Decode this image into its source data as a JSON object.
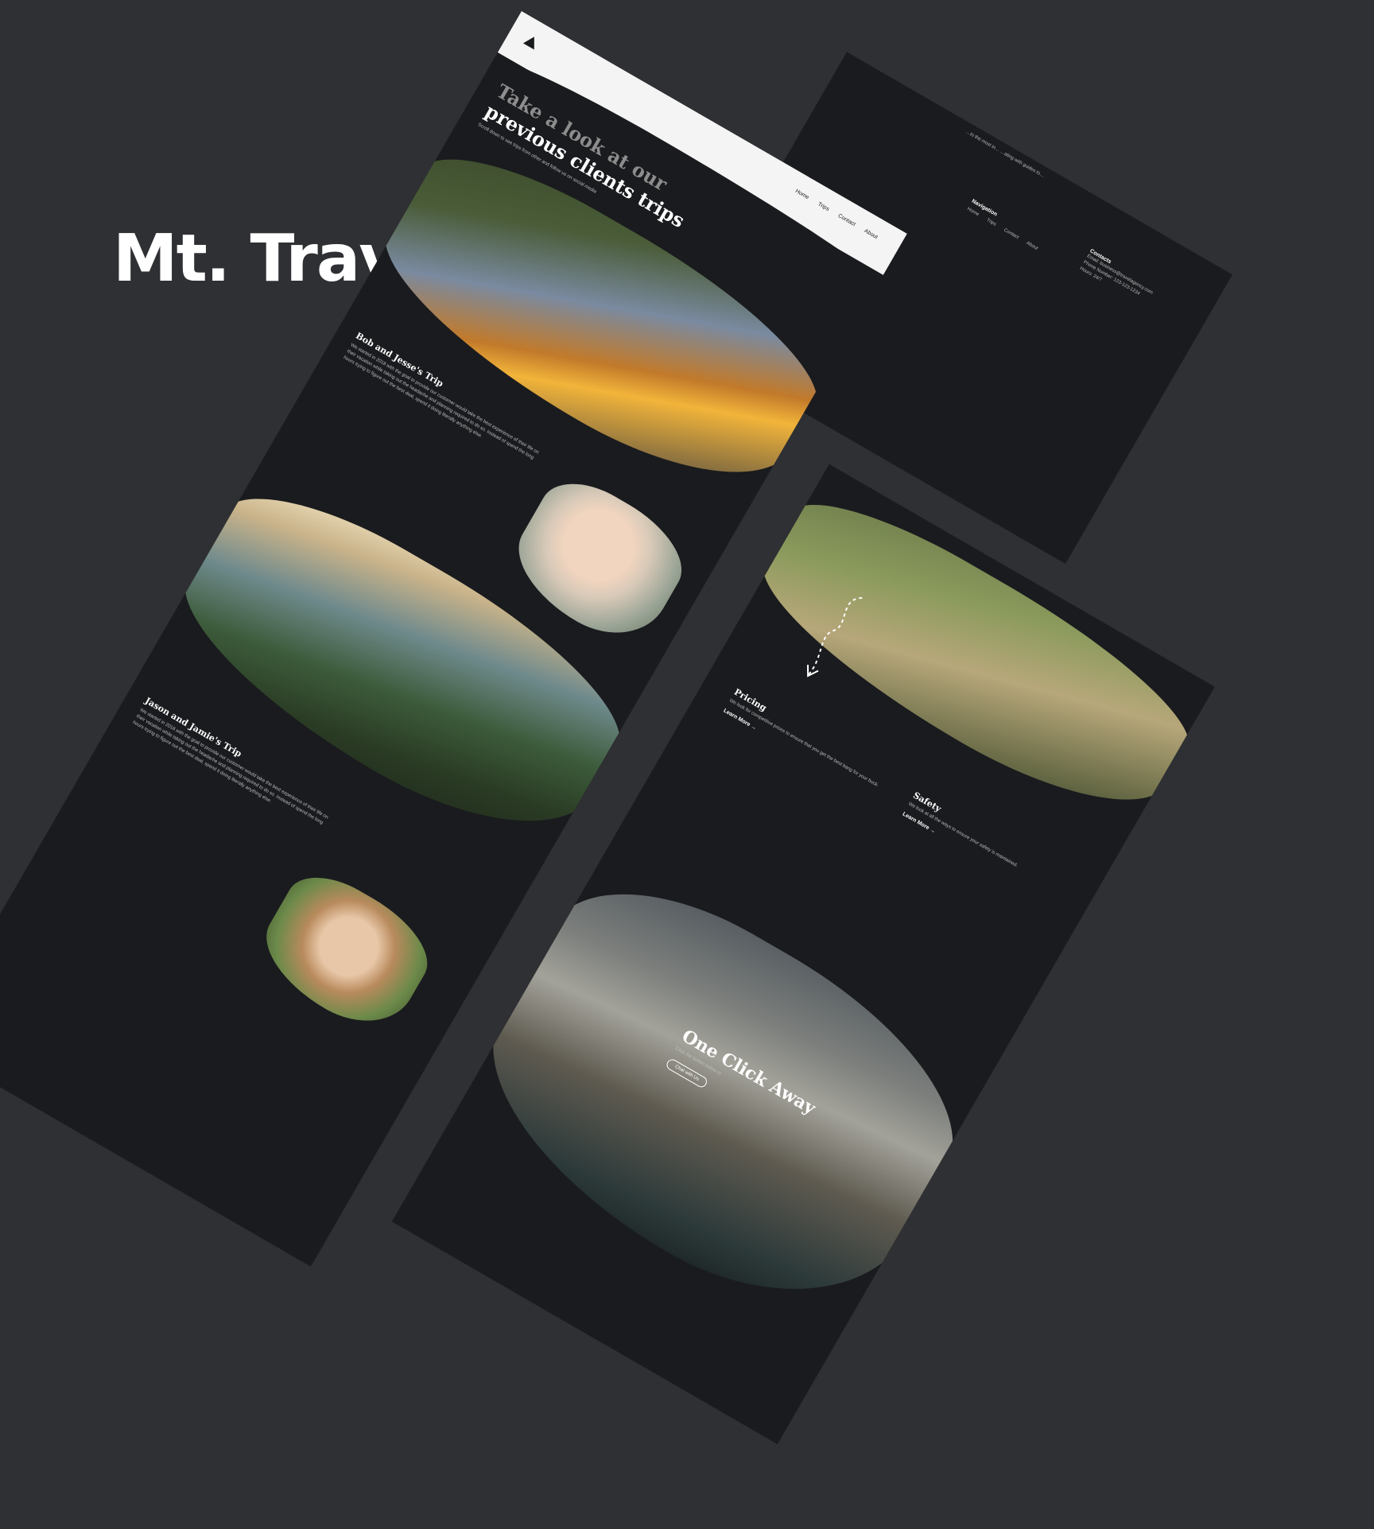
{
  "headline": "Mt. Travel Agency",
  "colors": {
    "background": "#2f3033",
    "board": "#1a1b1e",
    "text": "#ffffff"
  },
  "footer": {
    "top_text": "…to the most in… …ating with guides to…",
    "nav_heading": "Navigation",
    "nav_links": [
      "Home",
      "Trips",
      "Contact",
      "About"
    ],
    "contacts_heading": "Contacts",
    "contacts_lines": [
      "Email: business@travelagency.com",
      "Phone Number: 123-123-1234",
      "Hours: 24/7"
    ]
  },
  "trips_page": {
    "nav_links": [
      "Home",
      "Trips",
      "Contact",
      "About"
    ],
    "hero_title_line1": "Take a look at our",
    "hero_title_line2": "previous clients trips",
    "hero_subtitle": "Scroll down to see trips from other and follow us on social media",
    "trip1": {
      "title": "Bob and Jesse's Trip",
      "text": "We started in 2018 with the goal to provide our customer would take the best experience of their life on their vacation while taking out the headache and planning required to do so. Instead of spend the long hours trying to figure out the best deal, spend it doing literally anything else."
    },
    "trip2": {
      "title": "Jason and Jamie's Trip",
      "text": "We started in 2018 with the goal to provide our customer would take the best experience of their life on their vacation while taking out the headache and planning required to do so. Instead of spend the long hours trying to figure out the best deal, spend it doing literally anything else."
    }
  },
  "home_page": {
    "pricing_title": "Pricing",
    "pricing_text": "We look for competitive prices to ensure that you get the best bang for your buck.",
    "pricing_link": "Learn More →",
    "safety_title": "Safety",
    "safety_text": "We look at all the ways to ensure your safety is maintained.",
    "safety_link": "Learn More →",
    "cta_title": "One Click Away",
    "cta_text": "Click the button below to",
    "cta_button": "Chat with Us"
  }
}
